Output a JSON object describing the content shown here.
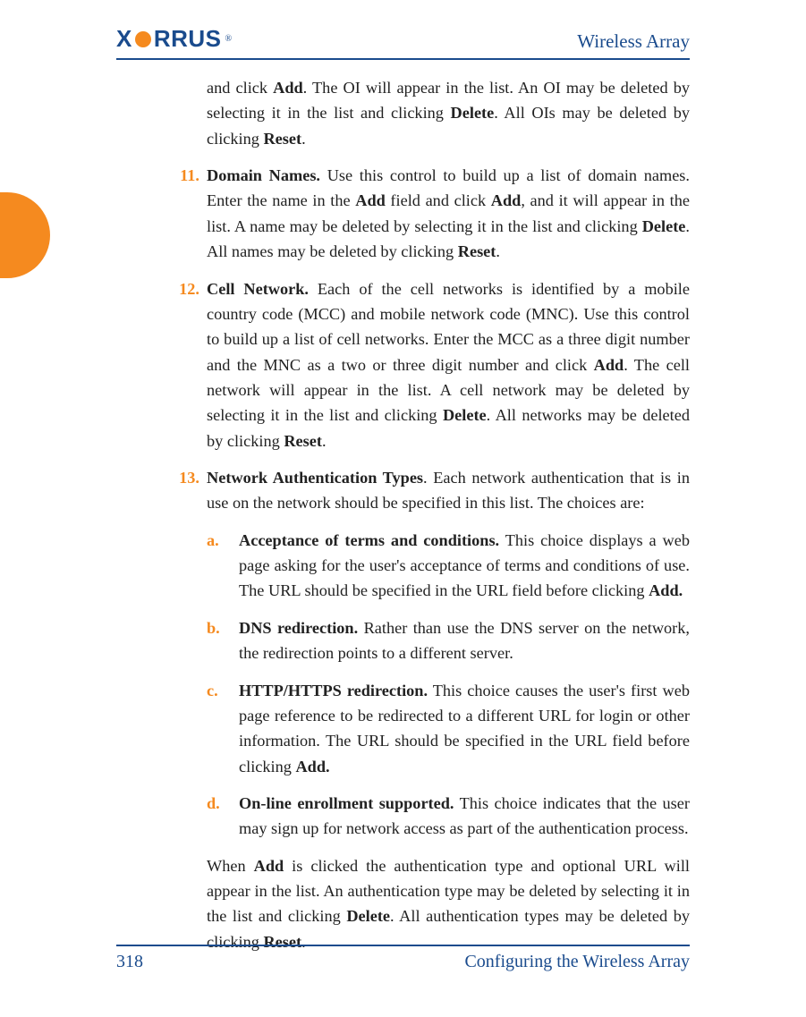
{
  "header": {
    "brand_prefix": "X",
    "brand_suffix": "RRUS",
    "title": "Wireless Array"
  },
  "leading_paragraph": "and click <b>Add</b>. The OI will appear in the list. An OI may be deleted by selecting it in the list and clicking <b>Delete</b>. All OIs may be deleted by clicking <b>Reset</b>.",
  "items": [
    {
      "number": "11.",
      "html": "<b>Domain Names.</b> Use this control to build up a list of domain names. Enter the name in the <b>Add</b> field and click <b>Add</b>, and it will appear in the list. A name may be deleted by selecting it in the list and clicking <b>Delete</b>. All names may be deleted by clicking <b>Reset</b>."
    },
    {
      "number": "12.",
      "html": "<b>Cell Network.</b> Each of the cell networks is identified by a mobile country code (MCC) and mobile network code (MNC). Use this control to build up a list of cell networks. Enter the MCC as a three digit number and the MNC as a two or three digit number and click <b>Add</b>. The cell network will appear in the list. A cell network may be deleted by selecting it in the list and clicking <b>Delete</b>. All networks may be deleted by clicking <b>Reset</b>."
    },
    {
      "number": "13.",
      "html": "<b>Network Authentication Types</b>. Each network authentication that is in use on the network should be specified in this list. The choices are:"
    }
  ],
  "sub_items": [
    {
      "letter": "a.",
      "html": "<b>Acceptance of terms and conditions.</b> This choice displays a web page asking for the user's acceptance of terms and conditions of use. The URL should be specified in the URL field before clicking <b>Add.</b>"
    },
    {
      "letter": "b.",
      "html": "<b>DNS redirection.</b> Rather than use the DNS server on the network, the redirection points to a different server."
    },
    {
      "letter": "c.",
      "html": "<b>HTTP/HTTPS redirection.</b> This choice causes the user's first web page reference to be redirected to a different URL for login or other information. The URL should be specified in the URL field before clicking <b>Add.</b>"
    },
    {
      "letter": "d.",
      "html": "<b>On-line enrollment supported.</b> This choice indicates that the user may sign up for network access as part of the authentication process."
    }
  ],
  "trailing_paragraph": "When <b>Add</b> is clicked the authentication type and optional URL will appear in the list. An authentication type may be deleted by selecting it in the list and clicking <b>Delete</b>. All authentication types may be deleted by clicking <b>Reset</b>.",
  "footer": {
    "page_number": "318",
    "section": "Configuring the Wireless Array"
  }
}
